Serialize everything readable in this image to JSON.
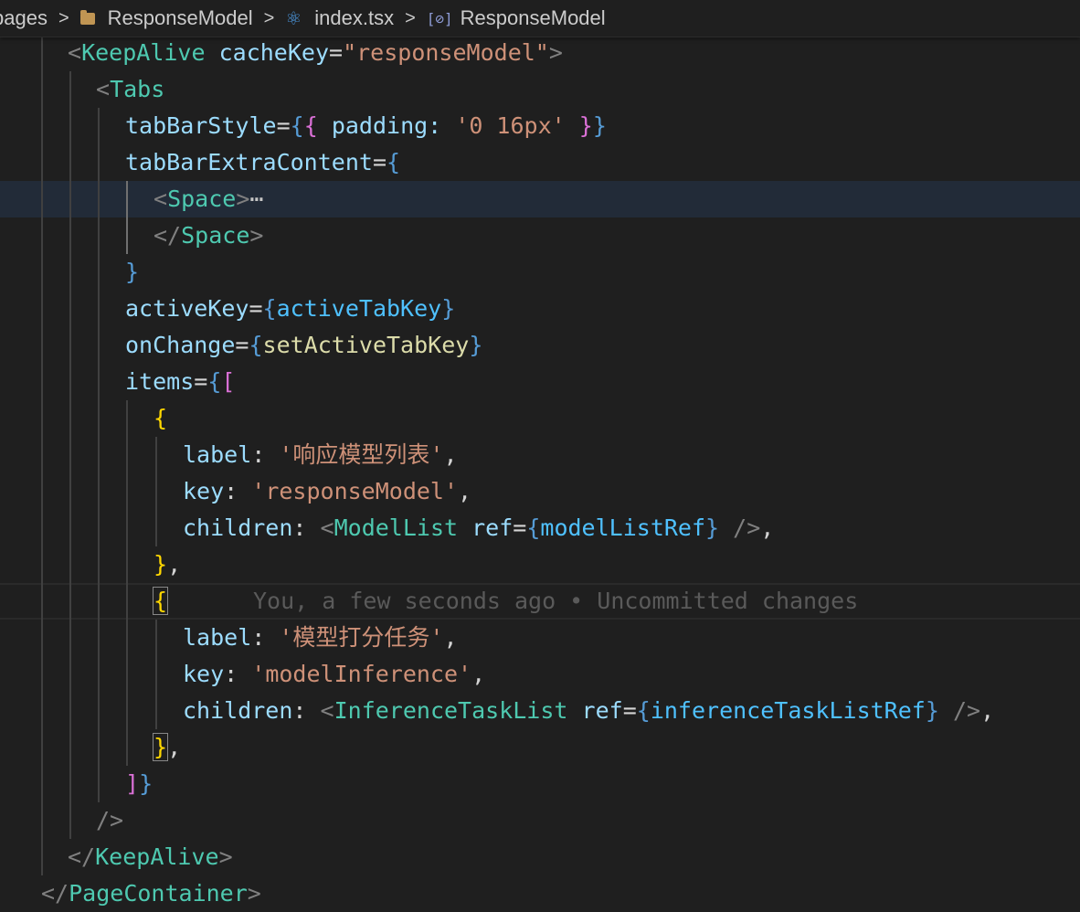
{
  "breadcrumb": {
    "items": [
      {
        "label": "pages",
        "icon": ""
      },
      {
        "label": "ResponseModel",
        "icon": "folder-icon"
      },
      {
        "label": "index.tsx",
        "icon": "react-icon"
      },
      {
        "label": "ResponseModel",
        "icon": "symbol-icon"
      }
    ],
    "separator": ">"
  },
  "code": {
    "blame": "You, a few seconds ago • Uncommitted changes",
    "fold_ellipsis": "⋯",
    "lines": [
      [
        [
          "<",
          "pun"
        ],
        [
          "KeepAlive",
          "tag"
        ],
        [
          " ",
          "plain"
        ],
        [
          "cacheKey",
          "attr"
        ],
        [
          "=",
          "plain"
        ],
        [
          "\"responseModel\"",
          "str"
        ],
        [
          ">",
          "pun"
        ]
      ],
      [
        [
          "<",
          "pun"
        ],
        [
          "Tabs",
          "tag"
        ]
      ],
      [
        [
          "tabBarStyle",
          "attr"
        ],
        [
          "=",
          "plain"
        ],
        [
          "{",
          "brk"
        ],
        [
          "{",
          "brk2"
        ],
        [
          " padding: ",
          "attr"
        ],
        [
          "'0 16px'",
          "str"
        ],
        [
          " ",
          "plain"
        ],
        [
          "}",
          "brk2"
        ],
        [
          "}",
          "brk"
        ]
      ],
      [
        [
          "tabBarExtraContent",
          "attr"
        ],
        [
          "=",
          "plain"
        ],
        [
          "{",
          "brk"
        ]
      ],
      [
        [
          "<",
          "pun"
        ],
        [
          "Space",
          "tag"
        ],
        [
          ">",
          "pun"
        ]
      ],
      [
        [
          "</",
          "pun"
        ],
        [
          "Space",
          "tag"
        ],
        [
          ">",
          "pun"
        ]
      ],
      [
        [
          "}",
          "brk"
        ]
      ],
      [
        [
          "activeKey",
          "attr"
        ],
        [
          "=",
          "plain"
        ],
        [
          "{",
          "brk"
        ],
        [
          "activeTabKey",
          "var"
        ],
        [
          "}",
          "brk"
        ]
      ],
      [
        [
          "onChange",
          "attr"
        ],
        [
          "=",
          "plain"
        ],
        [
          "{",
          "brk"
        ],
        [
          "setActiveTabKey",
          "fn"
        ],
        [
          "}",
          "brk"
        ]
      ],
      [
        [
          "items",
          "attr"
        ],
        [
          "=",
          "plain"
        ],
        [
          "{",
          "brk"
        ],
        [
          "[",
          "brk2"
        ]
      ],
      [
        [
          "{",
          "brk3"
        ]
      ],
      [
        [
          "label",
          "attr"
        ],
        [
          ": ",
          "plain"
        ],
        [
          "'响应模型列表'",
          "str"
        ],
        [
          ",",
          "plain"
        ]
      ],
      [
        [
          "key",
          "attr"
        ],
        [
          ": ",
          "plain"
        ],
        [
          "'responseModel'",
          "str"
        ],
        [
          ",",
          "plain"
        ]
      ],
      [
        [
          "children",
          "attr"
        ],
        [
          ": ",
          "plain"
        ],
        [
          "<",
          "pun"
        ],
        [
          "ModelList",
          "tag"
        ],
        [
          " ",
          "plain"
        ],
        [
          "ref",
          "attr"
        ],
        [
          "=",
          "plain"
        ],
        [
          "{",
          "brk"
        ],
        [
          "modelListRef",
          "var"
        ],
        [
          "}",
          "brk"
        ],
        [
          " />",
          "pun"
        ],
        [
          ",",
          "plain"
        ]
      ],
      [
        [
          "}",
          "brk3"
        ],
        [
          ",",
          "plain"
        ]
      ],
      [
        [
          "{",
          "brk3"
        ]
      ],
      [
        [
          "label",
          "attr"
        ],
        [
          ": ",
          "plain"
        ],
        [
          "'模型打分任务'",
          "str"
        ],
        [
          ",",
          "plain"
        ]
      ],
      [
        [
          "key",
          "attr"
        ],
        [
          ": ",
          "plain"
        ],
        [
          "'modelInference'",
          "str"
        ],
        [
          ",",
          "plain"
        ]
      ],
      [
        [
          "children",
          "attr"
        ],
        [
          ": ",
          "plain"
        ],
        [
          "<",
          "pun"
        ],
        [
          "InferenceTaskList",
          "tag"
        ],
        [
          " ",
          "plain"
        ],
        [
          "ref",
          "attr"
        ],
        [
          "=",
          "plain"
        ],
        [
          "{",
          "brk"
        ],
        [
          "inferenceTaskListRef",
          "var"
        ],
        [
          "}",
          "brk"
        ],
        [
          " />",
          "pun"
        ],
        [
          ",",
          "plain"
        ]
      ],
      [
        [
          "}",
          "brk3"
        ],
        [
          ",",
          "plain"
        ]
      ],
      [
        [
          "]",
          "brk2"
        ],
        [
          "}",
          "brk"
        ]
      ],
      [
        [
          "/>",
          "pun"
        ]
      ],
      [
        [
          "</",
          "pun"
        ],
        [
          "KeepAlive",
          "tag"
        ],
        [
          ">",
          "pun"
        ]
      ],
      [
        [
          "</",
          "pun"
        ],
        [
          "PageContainer",
          "tag"
        ],
        [
          ">",
          "pun"
        ]
      ]
    ]
  }
}
